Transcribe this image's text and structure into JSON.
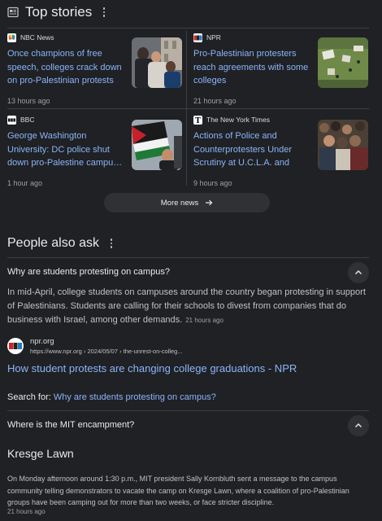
{
  "header": {
    "title": "Top stories",
    "icon": "newspaper-icon"
  },
  "stories": [
    {
      "source": "NBC News",
      "logo": "nbc-peacock",
      "headline": "Once champions of free speech, colleges crack down on pro-Palestinian protests",
      "time": "13 hours ago"
    },
    {
      "source": "NPR",
      "logo": "npr",
      "headline": "Pro-Palestinian protesters reach agreements with some colleges",
      "time": "21 hours ago"
    },
    {
      "source": "BBC",
      "logo": "bbc",
      "headline": "George Washington University: DC police shut down pro-Palestine campu…",
      "time": "1 hour ago"
    },
    {
      "source": "The New York Times",
      "logo": "nyt",
      "headline": "Actions of Police and Counterprotesters Under Scrutiny at U.C.L.A. and Ol…",
      "time": "9 hours ago"
    }
  ],
  "more_news": {
    "label": "More news"
  },
  "paa": {
    "title": "People also ask",
    "questions": [
      {
        "question": "Why are students protesting on campus?",
        "answer": "In mid-April, college students on campuses around the country began protesting in support of Palestinians. Students are calling for their schools to divest from companies that do business with Israel, among other demands.",
        "answer_time": "21 hours ago",
        "source_site": "npr.org",
        "source_url": "https://www.npr.org › 2024/05/07 › the-unrest-on-colleg...",
        "result_title": "How student protests are changing college graduations - NPR",
        "search_for_label": "Search for:",
        "search_for_query": "Why are students protesting on campus?"
      },
      {
        "question": "Where is the MIT encampment?",
        "answer_title": "Kresge Lawn",
        "answer": "On Monday afternoon around 1:30 p.m., MIT president Sally Kornbluth sent a message to the campus community telling demonstrators to vacate the camp on Kresge Lawn, where a coalition of pro-Palestinian groups have been camping out for more than two weeks, or face stricter discipline.",
        "answer_time": "21 hours ago"
      }
    ]
  },
  "colors": {
    "background": "#202124",
    "link": "#8ab4f8",
    "text": "#e8eaed",
    "muted": "#9aa0a6"
  }
}
